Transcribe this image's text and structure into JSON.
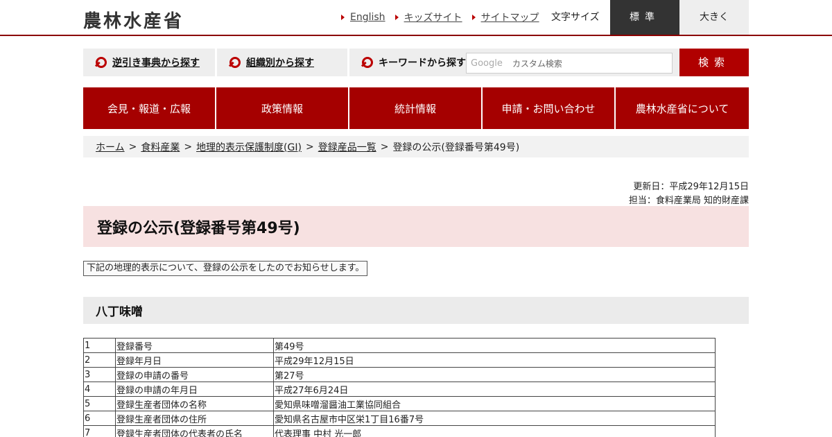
{
  "header": {
    "logo": "農林水産省",
    "links": [
      "English",
      "キッズサイト",
      "サイトマップ"
    ],
    "font_size_label": "文字サイズ",
    "font_standard": "標準",
    "font_large": "大きく"
  },
  "search": {
    "reverse_lookup": "逆引き事典から探す",
    "by_org": "組織別から探す",
    "keyword_label": "キーワードから探す",
    "google_label": "Google",
    "placeholder": "カスタム検索",
    "button": "検索"
  },
  "gnav": [
    "会見・報道・広報",
    "政策情報",
    "統計情報",
    "申請・お問い合わせ",
    "農林水産省について"
  ],
  "breadcrumb": {
    "items": [
      "ホーム",
      "食料産業",
      "地理的表示保護制度(GI)",
      "登録産品一覧"
    ],
    "current": "登録の公示(登録番号第49号)"
  },
  "meta": {
    "updated": "更新日：平成29年12月15日",
    "contact": "担当：食料産業局 知的財産課"
  },
  "page_title": "登録の公示(登録番号第49号)",
  "notice": "下記の地理的表示について、登録の公示をしたのでお知らせします。",
  "section_title": "八丁味噌",
  "table": [
    [
      "1",
      "登録番号",
      "第49号"
    ],
    [
      "2",
      "登録年月日",
      "平成29年12月15日"
    ],
    [
      "3",
      "登録の申請の番号",
      "第27号"
    ],
    [
      "4",
      "登録の申請の年月日",
      "平成27年6月24日"
    ],
    [
      "5",
      "登録生産者団体の名称",
      "愛知県味噌溜醤油工業協同組合"
    ],
    [
      "6",
      "登録生産者団体の住所",
      "愛知県名古屋市中区栄1丁目16番7号"
    ],
    [
      "7",
      "登録生産者団体の代表者の氏名",
      "代表理事 中村 光一郎"
    ]
  ]
}
